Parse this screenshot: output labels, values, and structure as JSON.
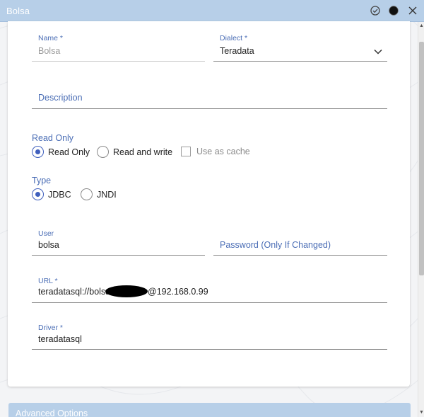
{
  "window": {
    "title": "Bolsa"
  },
  "fields": {
    "name": {
      "label": "Name *",
      "value": "Bolsa"
    },
    "dialect": {
      "label": "Dialect *",
      "value": "Teradata"
    },
    "description": {
      "placeholder": "Description"
    },
    "user": {
      "label": "User",
      "value": "bolsa"
    },
    "password": {
      "placeholder": "Password (Only If Changed)"
    },
    "url": {
      "label": "URL *",
      "value_prefix": "teradatasql://bolsa",
      "value_suffix": "@192.168.0.99"
    },
    "driver": {
      "label": "Driver *",
      "value": "teradatasql"
    }
  },
  "read_only": {
    "label": "Read Only",
    "options": [
      "Read Only",
      "Read and write"
    ],
    "selected": "Read Only",
    "cache_label": "Use as cache",
    "cache_checked": false
  },
  "type": {
    "label": "Type",
    "options": [
      "JDBC",
      "JNDI"
    ],
    "selected": "JDBC"
  },
  "advanced": {
    "label": "Advanced Options"
  },
  "colors": {
    "accent": "#3f5fbd",
    "label": "#4a6db5",
    "titlebar": "#b7cfe8"
  },
  "icons": [
    "check-circle-icon",
    "record-icon",
    "close-icon",
    "chevron-down-icon"
  ]
}
